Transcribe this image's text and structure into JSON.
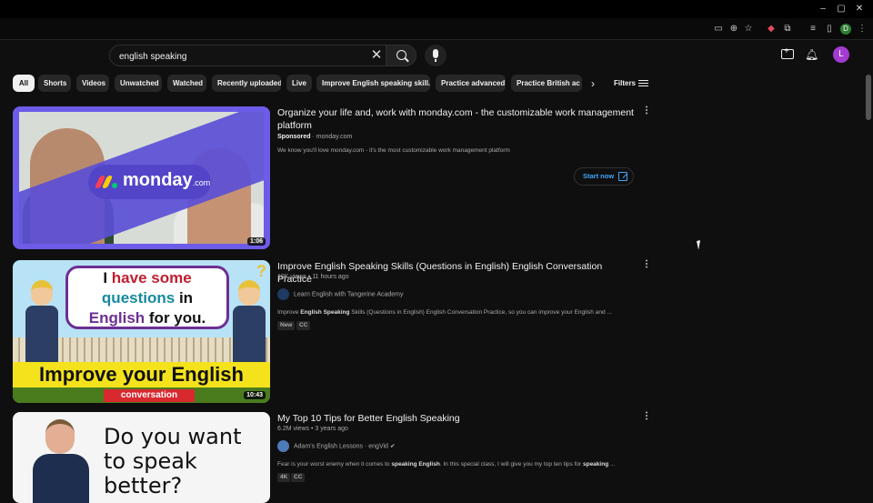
{
  "browser": {
    "window_controls": [
      "–",
      "▢",
      "✕"
    ],
    "profile_initial": "D"
  },
  "header": {
    "search_value": "english speaking",
    "avatar_initial": "L"
  },
  "chips": [
    {
      "label": "All",
      "active": true
    },
    {
      "label": "Shorts"
    },
    {
      "label": "Videos"
    },
    {
      "label": "Unwatched"
    },
    {
      "label": "Watched"
    },
    {
      "label": "Recently uploaded"
    },
    {
      "label": "Live"
    },
    {
      "label": "Improve English speaking skill..."
    },
    {
      "label": "Practice advanced"
    },
    {
      "label": "Practice British ac"
    }
  ],
  "filters_label": "Filters",
  "results": [
    {
      "title": "Organize your life and, work with monday.com - the customizable work management platform",
      "sponsored": "Sponsored",
      "domain": "· monday.com",
      "description": "We know you'll love monday.com - it's the most customizable work management platform",
      "cta_label": "Start now",
      "duration": "1:06",
      "thumb_text": "monday",
      "thumb_suffix": ".com"
    },
    {
      "title": "Improve English Speaking Skills (Questions in English) English Conversation Practice",
      "meta": "10K views • 11 hours ago",
      "channel": "Learn English with Tangerine Academy",
      "description_pre": "Improve ",
      "description_bold": "English Speaking",
      "description_post": " Skills (Questions in English) English Conversation Practice, so you can improve your English and ...",
      "badges": [
        "New",
        "CC"
      ],
      "duration": "10:43",
      "thumb": {
        "l1_a": "I ",
        "l1_b": "have some",
        "l2_a": "questions",
        "l2_b": " in",
        "l3_a": "English",
        "l3_b": " for you.",
        "banner": "Improve your English",
        "sub": "conversation",
        "qmark": "?"
      }
    },
    {
      "title": "My Top 10 Tips for Better English Speaking",
      "meta": "6.2M views • 3 years ago",
      "channel": "Adam's English Lessons · engVid",
      "description_pre": "Fear is your worst enemy when it comes to ",
      "description_bold": "speaking English",
      "description_post": ". In this special class, I will give you my top ten tips for ",
      "description_bold2": "speaking",
      "description_tail": " ...",
      "badges": [
        "4K",
        "CC"
      ],
      "thumb_text": "Do you want to speak better?"
    }
  ],
  "colors": {
    "accent_blue": "#3ea6ff",
    "avatar": "#a23bd0",
    "background": "#0f0f0f"
  }
}
